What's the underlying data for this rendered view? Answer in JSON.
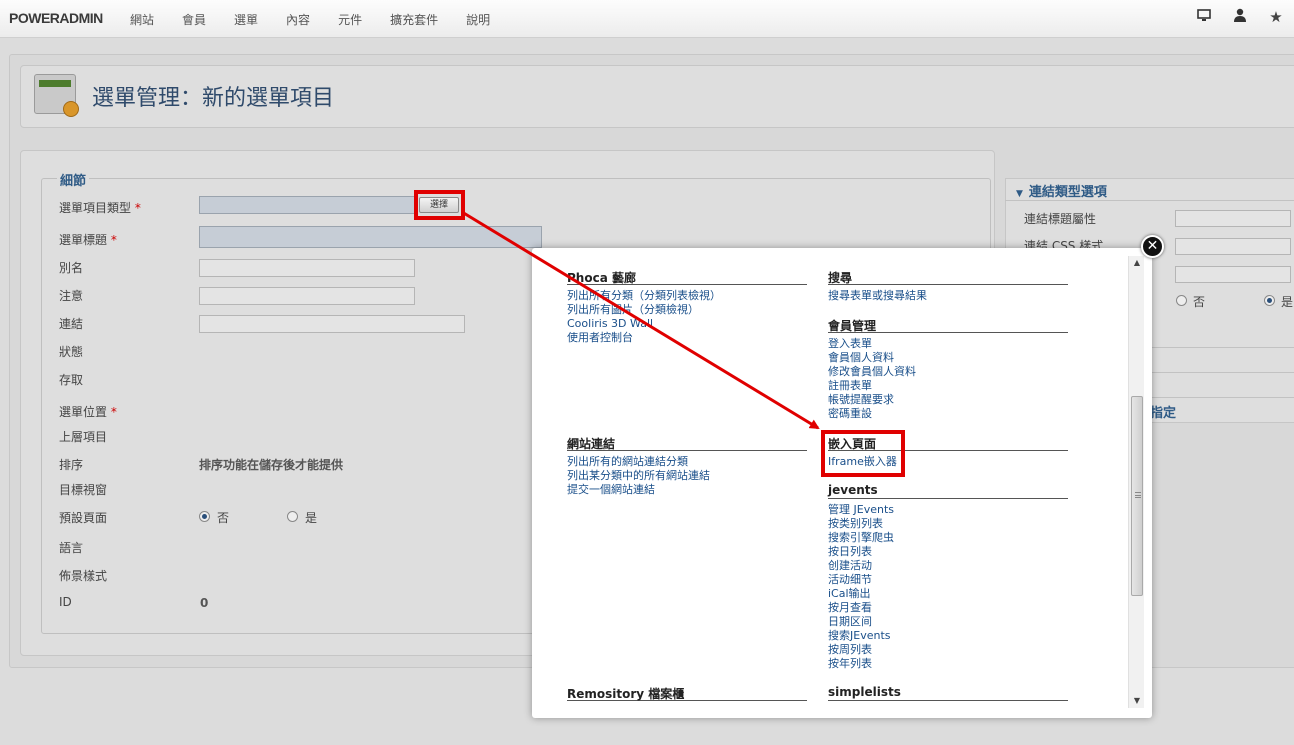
{
  "topbar": {
    "brand": "POWERADMIN",
    "nav": [
      "網站",
      "會員",
      "選單",
      "內容",
      "元件",
      "擴充套件",
      "說明"
    ],
    "icons": [
      "monitor-icon",
      "user-icon",
      "star-icon"
    ]
  },
  "header": {
    "title": "選單管理：新的選單項目"
  },
  "details": {
    "legend": "細節",
    "labels": {
      "menu_item_type": "選單項目類型",
      "menu_title": "選單標題",
      "alias": "別名",
      "note": "注意",
      "link": "連結",
      "status": "狀態",
      "access": "存取",
      "menu_location": "選單位置",
      "parent_item": "上層項目",
      "ordering": "排序",
      "target_window": "目標視窗",
      "default_page": "預設頁面",
      "language": "語言",
      "template_style": "佈景樣式",
      "id": "ID"
    },
    "required_mark": "*",
    "select_button": "選擇",
    "ordering_value": "排序功能在儲存後才能提供",
    "default_page_options": [
      "否",
      "是"
    ],
    "default_page_selected": "否",
    "id_value": "0"
  },
  "right_panel": {
    "title": "連結類型選項",
    "labels": [
      "連結標題屬性",
      "連結 CSS 樣式"
    ],
    "radio_options": [
      "否",
      "是"
    ],
    "section2_fragment": "指定"
  },
  "modal": {
    "close": "✕",
    "left_column": [
      {
        "title": "Phoca 藝廊",
        "links": [
          "列出所有分類（分類列表檢視）",
          "列出所有圖片（分類檢視）",
          "Cooliris 3D Wall",
          "使用者控制台"
        ]
      },
      {
        "title": "網站連結",
        "links": [
          "列出所有的網站連結分類",
          "列出某分類中的所有網站連結",
          "提交一個網站連結"
        ]
      },
      {
        "title": "Remository 檔案櫃",
        "links": []
      }
    ],
    "right_column": [
      {
        "title": "搜尋",
        "links": [
          "搜尋表單或搜尋結果"
        ]
      },
      {
        "title": "會員管理",
        "links": [
          "登入表單",
          "會員個人資料",
          "修改會員個人資料",
          "註冊表單",
          "帳號提醒要求",
          "密碼重設"
        ]
      },
      {
        "title": "嵌入頁面",
        "links": [
          "Iframe嵌入器"
        ]
      },
      {
        "title": "jevents",
        "links": [
          "管理 JEvents",
          "按类别列表",
          "搜索引擎爬虫",
          "按日列表",
          "创建活动",
          "活动细节",
          "iCal输出",
          "按月查看",
          "日期区间",
          "搜索JEvents",
          "按周列表",
          "按年列表"
        ]
      },
      {
        "title": "simplelists",
        "links": []
      }
    ]
  },
  "colors": {
    "link": "#1a4f8a",
    "highlight": "#e00000",
    "title": "#2f4a6b"
  }
}
